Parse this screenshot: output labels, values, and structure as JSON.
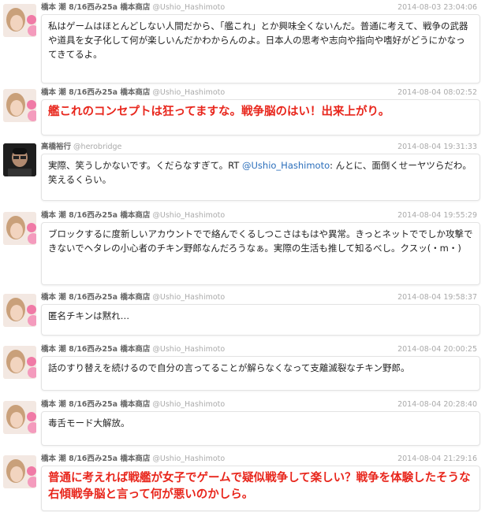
{
  "tweets": [
    {
      "name": "橋本 潮 8/16西み25a 橋本商店",
      "handle": "@Ushio_Hashimoto",
      "time": "2014-08-03 23:04:06",
      "text": "私はゲームはほとんどしない人間だから、「艦これ」とか興味全くないんだ。普通に考えて、戦争の武器や道具を女子化して何が楽しいんだかわからんのよ。日本人の思考や志向や指向や嗜好がどうにかなってきてるよ。"
    },
    {
      "name": "橋本 潮 8/16西み25a 橋本商店",
      "handle": "@Ushio_Hashimoto",
      "time": "2014-08-04 08:02:52",
      "text": "艦これのコンセプトは狂ってますな。戦争脳のはい！出来上がり。"
    },
    {
      "name": "高橋裕行",
      "handle": "@herobridge",
      "time": "2014-08-04 19:31:33",
      "text_before": "実際、笑うしかないです。くだらなすぎて。RT ",
      "mention": "@Ushio_Hashimoto",
      "text_after": ": んとに、面倒くせーヤツらだわ。笑えるくらい。"
    },
    {
      "name": "橋本 潮 8/16西み25a 橋本商店",
      "handle": "@Ushio_Hashimoto",
      "time": "2014-08-04 19:55:29",
      "text": "ブロックするに度新しいアカウントでで絡んでくるしつこさはもはや異常。きっとネットででしか攻撃できないでヘタレの小心者のチキン野郎なんだろうなぁ。実際の生活も推して知るべし。クスッ(・m・)"
    },
    {
      "name": "橋本 潮 8/16西み25a 橋本商店",
      "handle": "@Ushio_Hashimoto",
      "time": "2014-08-04 19:58:37",
      "text": "匿名チキンは黙れ…"
    },
    {
      "name": "橋本 潮 8/16西み25a 橋本商店",
      "handle": "@Ushio_Hashimoto",
      "time": "2014-08-04 20:00:25",
      "text": "話のすり替えを続けるので自分の言ってることが解らなくなって支離滅裂なチキン野郎。"
    },
    {
      "name": "橋本 潮 8/16西み25a 橋本商店",
      "handle": "@Ushio_Hashimoto",
      "time": "2014-08-04 20:28:40",
      "text": "毒舌モード大解放。"
    },
    {
      "name": "橋本 潮 8/16西み25a 橋本商店",
      "handle": "@Ushio_Hashimoto",
      "time": "2014-08-04 21:29:16",
      "text": "普通に考えれば戦艦が女子でゲームで疑似戦争して楽しい？戦争を体験したそうな右傾戦争脳と言って何が悪いのかしら。"
    }
  ],
  "colors": {
    "highlight_text": "#e8261c",
    "mention": "#2a6ebb"
  }
}
